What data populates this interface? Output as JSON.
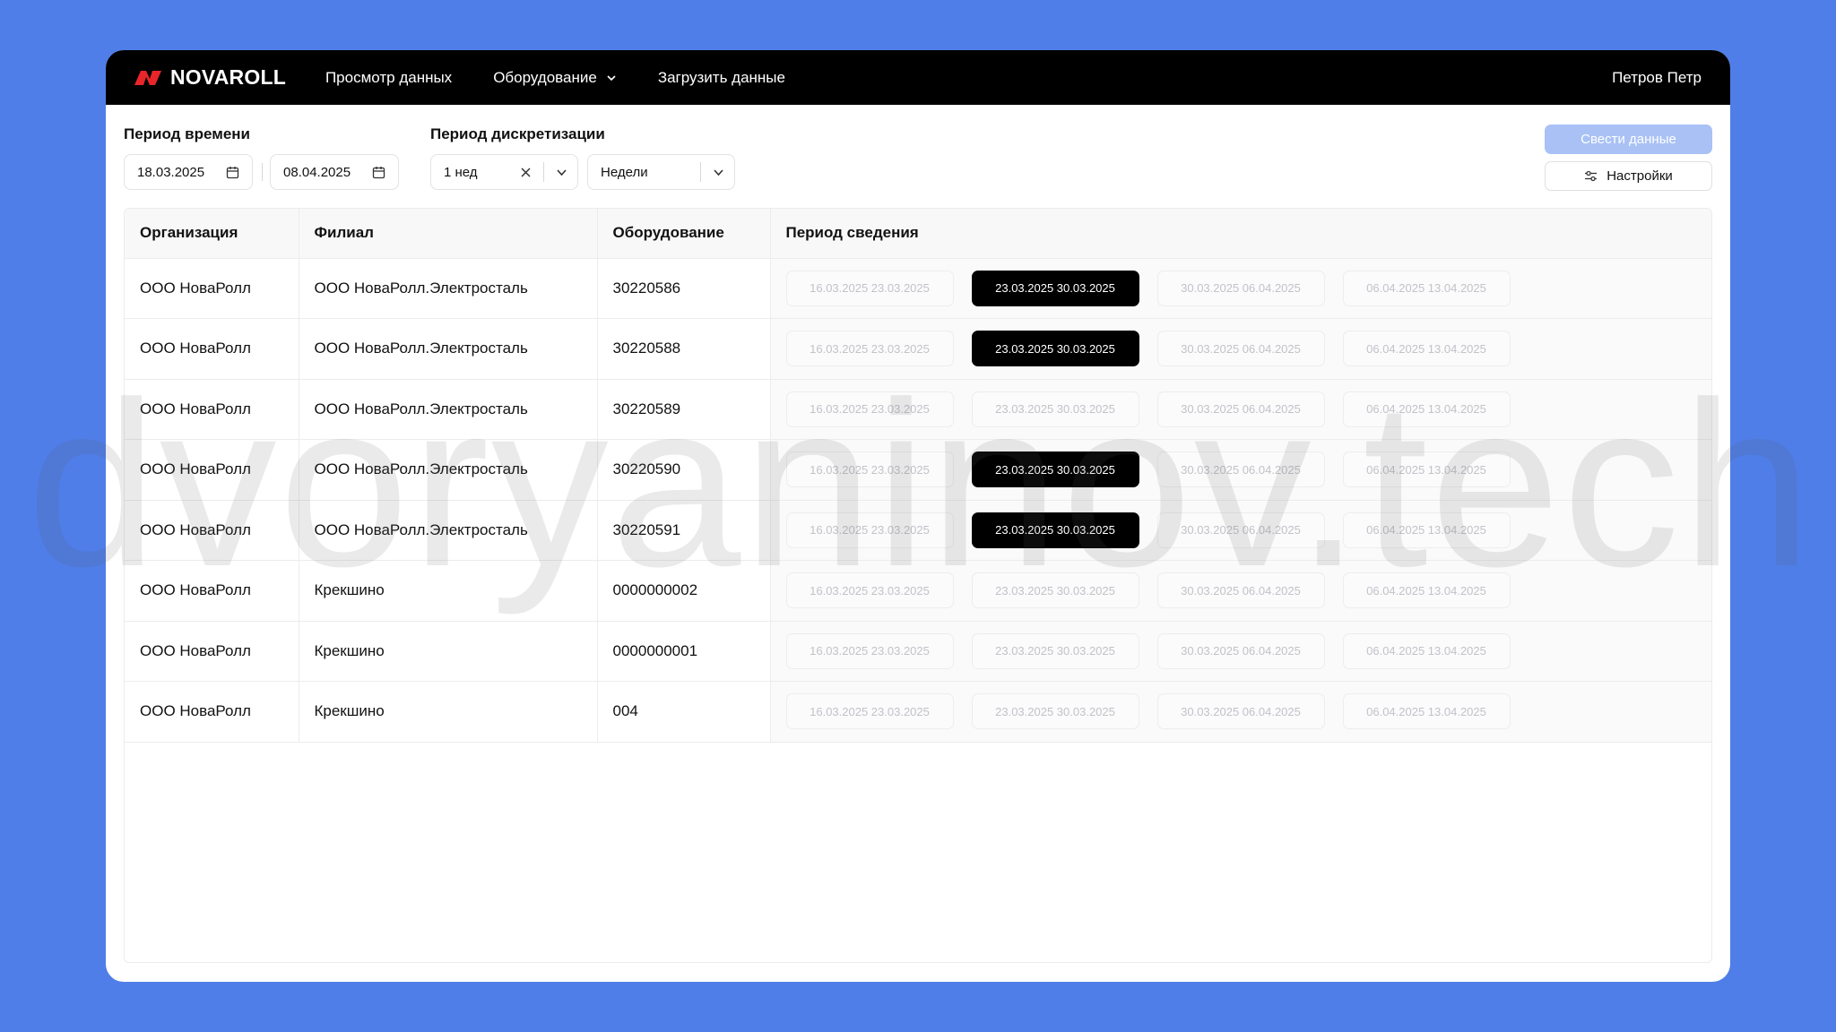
{
  "header": {
    "logo": "NOVAROLL",
    "nav": [
      {
        "label": "Просмотр данных"
      },
      {
        "label": "Оборудование"
      },
      {
        "label": "Загрузить данные"
      }
    ],
    "user": "Петров Петр"
  },
  "filters": {
    "time_period_label": "Период времени",
    "date_from": "18.03.2025",
    "date_to": "08.04.2025",
    "discretization_label": "Период дискретизации",
    "discretization_value": "1 нед",
    "discretization_unit": "Недели",
    "apply_label": "Свести данные",
    "settings_label": "Настройки"
  },
  "table": {
    "headers": [
      "Организация",
      "Филиал",
      "Оборудование",
      "Период сведения"
    ],
    "periods": [
      "16.03.2025 23.03.2025",
      "23.03.2025 30.03.2025",
      "30.03.2025 06.04.2025",
      "06.04.2025 13.04.2025"
    ],
    "rows": [
      {
        "org": "ООО НоваРолл",
        "branch": "ООО НоваРолл.Электросталь",
        "equipment": "30220586",
        "active": [
          1
        ]
      },
      {
        "org": "ООО НоваРолл",
        "branch": "ООО НоваРолл.Электросталь",
        "equipment": "30220588",
        "active": [
          1
        ]
      },
      {
        "org": "ООО НоваРолл",
        "branch": "ООО НоваРолл.Электросталь",
        "equipment": "30220589",
        "active": []
      },
      {
        "org": "ООО НоваРолл",
        "branch": "ООО НоваРолл.Электросталь",
        "equipment": "30220590",
        "active": [
          1
        ]
      },
      {
        "org": "ООО НоваРолл",
        "branch": "ООО НоваРолл.Электросталь",
        "equipment": "30220591",
        "active": [
          1
        ]
      },
      {
        "org": "ООО НоваРолл",
        "branch": "Крекшино",
        "equipment": "0000000002",
        "active": []
      },
      {
        "org": "ООО НоваРолл",
        "branch": "Крекшино",
        "equipment": "0000000001",
        "active": []
      },
      {
        "org": "ООО НоваРолл",
        "branch": "Крекшино",
        "equipment": "004",
        "active": []
      }
    ]
  },
  "watermark": "dvoryaninov.tech",
  "colors": {
    "background": "#4f7ee8",
    "topbar": "#000000",
    "logo_accent": "#e8262a",
    "apply_button": "#a9c1f5"
  }
}
